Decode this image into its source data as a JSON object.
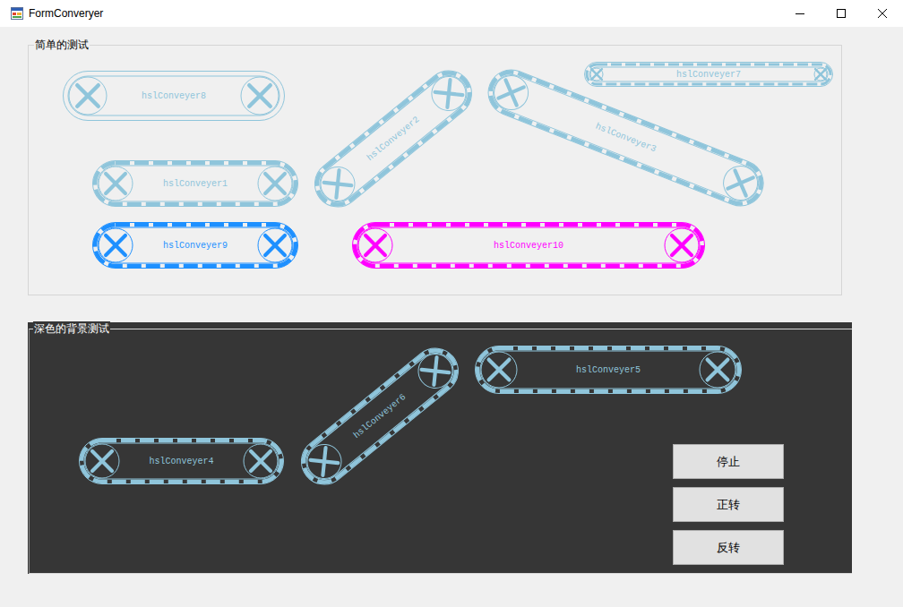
{
  "window": {
    "title": "FormConveryer"
  },
  "groups": [
    {
      "title": "简单的测试",
      "kind": "light",
      "conveyors": [
        {
          "name": "hslConveyer8",
          "color": "#8fc5db",
          "dashed": false
        },
        {
          "name": "hslConveyer2",
          "color": "#8fc5db",
          "dashed": true
        },
        {
          "name": "hslConveyer3",
          "color": "#8fc5db",
          "dashed": true
        },
        {
          "name": "hslConveyer7",
          "color": "#8fc5db",
          "dashed": true
        },
        {
          "name": "hslConveyer1",
          "color": "#8fc5db",
          "dashed": true
        },
        {
          "name": "hslConveyer9",
          "color": "#1e90ff",
          "dashed": true
        },
        {
          "name": "hslConveyer10",
          "color": "#ff00ff",
          "dashed": true
        }
      ],
      "buttons": []
    },
    {
      "title": "深色的背景测试",
      "kind": "dark",
      "conveyors": [
        {
          "name": "hslConveyer5",
          "color": "#8fc5db",
          "dashed": true
        },
        {
          "name": "hslConveyer4",
          "color": "#8fc5db",
          "dashed": true
        },
        {
          "name": "hslConveyer6",
          "color": "#8fc5db",
          "dashed": true
        }
      ],
      "buttons": [
        "停止",
        "正转",
        "反转"
      ]
    }
  ]
}
